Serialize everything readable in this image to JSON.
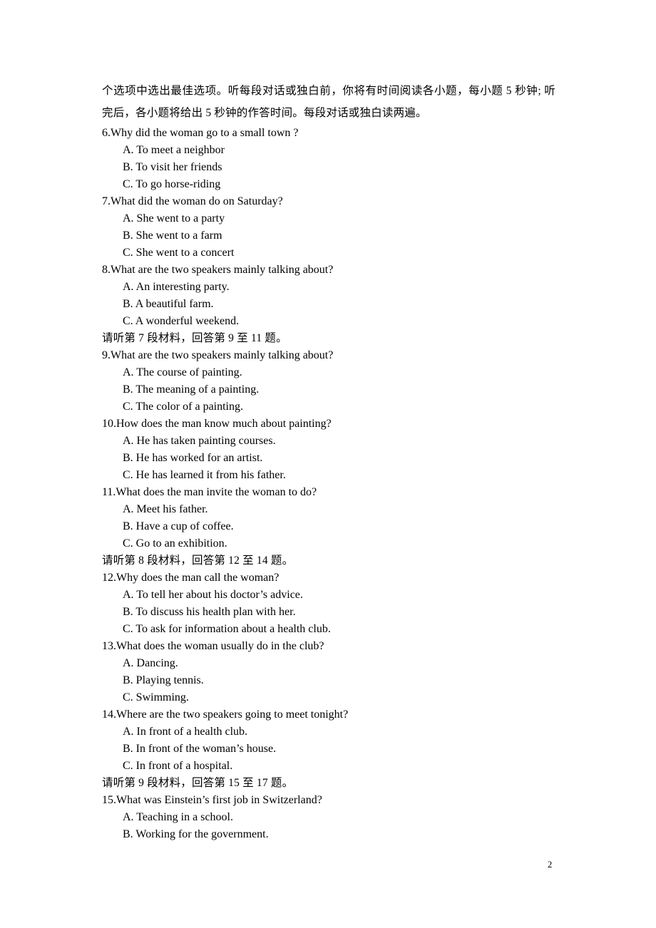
{
  "document": {
    "page_number": "2",
    "intro_paragraph": "个选项中选出最佳选项。听每段对话或独白前，你将有时间阅读各小题，每小题 5 秒钟; 听完后，各小题将给出 5 秒钟的作答时间。每段对话或独白读两遍。",
    "blocks": [
      {
        "type": "question",
        "number": "6.",
        "stem": "6.Why did the woman go to a small town ?",
        "options": [
          "A. To meet a neighbor",
          "B. To visit her friends",
          "C. To go horse-riding"
        ]
      },
      {
        "type": "question",
        "number": "7.",
        "stem": "7.What did the woman do on Saturday?",
        "options": [
          "A. She went to a party",
          "B. She went to a farm",
          "C. She went to a concert"
        ]
      },
      {
        "type": "question",
        "number": "8.",
        "stem": "8.What are the two speakers mainly talking about?",
        "options": [
          "A. An interesting party.",
          "B. A beautiful farm.",
          "C. A wonderful weekend."
        ]
      },
      {
        "type": "directive",
        "text": "请听第 7 段材料，回答第 9 至 11 题。"
      },
      {
        "type": "question",
        "number": "9.",
        "stem": "9.What are the two speakers mainly talking about?",
        "options": [
          "A. The course of painting.",
          "B. The meaning of a painting.",
          "C. The color of a painting."
        ]
      },
      {
        "type": "question",
        "number": "10.",
        "stem": "10.How does the man know much about painting?",
        "options": [
          "A. He has taken painting courses.",
          "B. He has worked for an artist.",
          "C. He has learned it from his father."
        ]
      },
      {
        "type": "question",
        "number": "11.",
        "stem": "11.What does the man invite the woman to do?",
        "options": [
          "A. Meet his father.",
          "B. Have a cup of coffee.",
          "C. Go to an exhibition."
        ]
      },
      {
        "type": "directive",
        "text": "请听第 8 段材料，回答第 12 至 14 题。"
      },
      {
        "type": "question",
        "number": "12.",
        "stem": "12.Why does the man call the woman?",
        "options": [
          "A. To tell her about his doctor’s advice.",
          "B. To discuss his health plan with her.",
          "C. To ask for information about a health club."
        ]
      },
      {
        "type": "question",
        "number": "13.",
        "stem": "13.What does the woman usually do in the club?",
        "options": [
          "A. Dancing.",
          "B. Playing tennis.",
          "C. Swimming."
        ]
      },
      {
        "type": "question",
        "number": "14.",
        "stem": "14.Where are the two speakers going to meet tonight?",
        "options": [
          "A. In front of a health club.",
          "B. In front of the woman’s house.",
          "C. In front of a hospital."
        ]
      },
      {
        "type": "directive",
        "text": "请听第 9 段材料，回答第 15 至 17 题。"
      },
      {
        "type": "question",
        "number": "15.",
        "stem": "15.What was Einstein’s first job in Switzerland?",
        "options": [
          "A. Teaching in a school.",
          "B. Working for the government."
        ]
      }
    ]
  }
}
